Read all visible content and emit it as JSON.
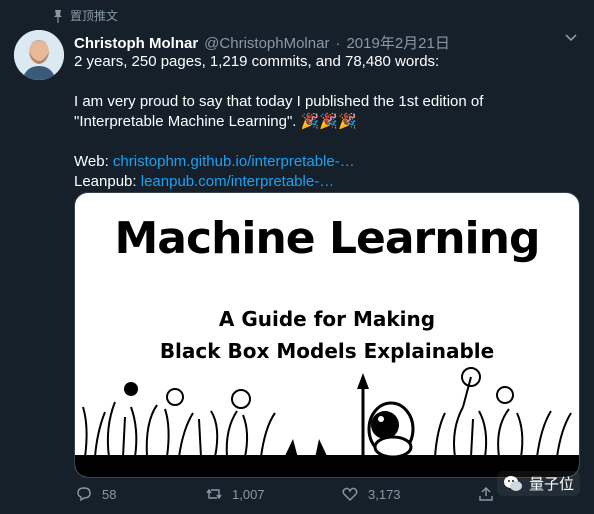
{
  "pinned": {
    "label": "置顶推文"
  },
  "tweet": {
    "author_name": "Christoph Molnar",
    "handle": "@ChristophMolnar",
    "dot": "·",
    "date": "2019年2月21日",
    "line1": "2 years, 250 pages, 1,219 commits, and 78,480 words:",
    "line2": "I am very proud to say that today I published the 1st edition of",
    "line3": "\"Interpretable Machine Learning\".",
    "emoji": "🎉🎉🎉",
    "web_label": "Web:",
    "web_link": "christophm.github.io/interpretable-…",
    "leanpub_label": "Leanpub:",
    "leanpub_link": "leanpub.com/interpretable-…"
  },
  "card": {
    "title": "Machine Learning",
    "subtitle_line1": "A Guide for Making",
    "subtitle_line2": "Black Box Models Explainable"
  },
  "actions": {
    "replies": "58",
    "retweets": "1,007",
    "likes": "3,173"
  },
  "watermark": {
    "text": "量子位"
  },
  "icons": [
    "pin-icon",
    "chevron-down-icon",
    "reply-icon",
    "retweet-icon",
    "like-icon",
    "share-icon",
    "wechat-icon"
  ]
}
